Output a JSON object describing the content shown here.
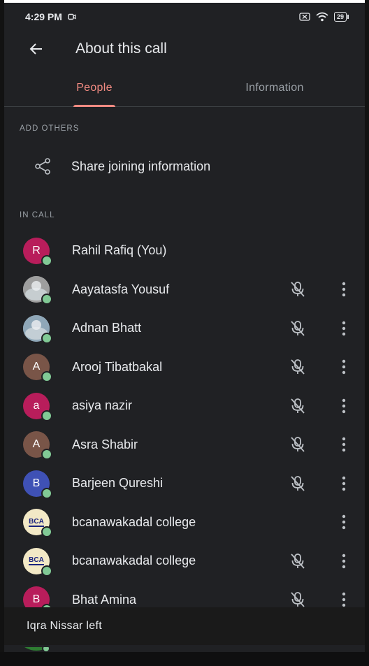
{
  "status_bar": {
    "time": "4:29 PM",
    "battery": "29"
  },
  "header": {
    "title": "About this call",
    "back_icon": "arrow-back-icon"
  },
  "tabs": [
    {
      "label": "People",
      "active": true
    },
    {
      "label": "Information",
      "active": false
    }
  ],
  "add_others": {
    "header": "ADD OTHERS",
    "share_label": "Share joining information",
    "icon": "share-icon"
  },
  "in_call": {
    "header": "IN CALL",
    "people": [
      {
        "name": "Rahil Rafiq (You)",
        "initial": "R",
        "avatar_color": "#b81d5b",
        "avatar_type": "initial",
        "muted": false,
        "more": false
      },
      {
        "name": "Aayatasfa Yousuf",
        "initial": "",
        "avatar_color": "#9e9e9e",
        "avatar_type": "photo",
        "muted": true,
        "more": true
      },
      {
        "name": "Adnan Bhatt",
        "initial": "",
        "avatar_color": "#8fa7b8",
        "avatar_type": "photo",
        "muted": true,
        "more": true
      },
      {
        "name": "Arooj Tibatbakal",
        "initial": "A",
        "avatar_color": "#795548",
        "avatar_type": "initial",
        "muted": true,
        "more": true
      },
      {
        "name": "asiya nazir",
        "initial": "a",
        "avatar_color": "#b81d5b",
        "avatar_type": "initial",
        "muted": true,
        "more": true
      },
      {
        "name": "Asra Shabir",
        "initial": "A",
        "avatar_color": "#795548",
        "avatar_type": "initial",
        "muted": true,
        "more": true
      },
      {
        "name": "Barjeen Qureshi",
        "initial": "B",
        "avatar_color": "#3f51b5",
        "avatar_type": "initial",
        "muted": true,
        "more": true
      },
      {
        "name": "bcanawakadal college",
        "initial": "",
        "avatar_color": "#d8c27a",
        "avatar_type": "logo",
        "logo_text": "BCA",
        "muted": false,
        "more": true
      },
      {
        "name": "bcanawakadal college",
        "initial": "",
        "avatar_color": "#d8c27a",
        "avatar_type": "logo",
        "logo_text": "BCA",
        "muted": true,
        "more": true
      },
      {
        "name": "Bhat Amina",
        "initial": "B",
        "avatar_color": "#b81d5b",
        "avatar_type": "initial",
        "muted": true,
        "more": true
      }
    ]
  },
  "snackbar": {
    "text": "Iqra Nissar left"
  },
  "colors": {
    "background": "#202124",
    "accent": "#f28b82",
    "presence": "#81c995"
  }
}
